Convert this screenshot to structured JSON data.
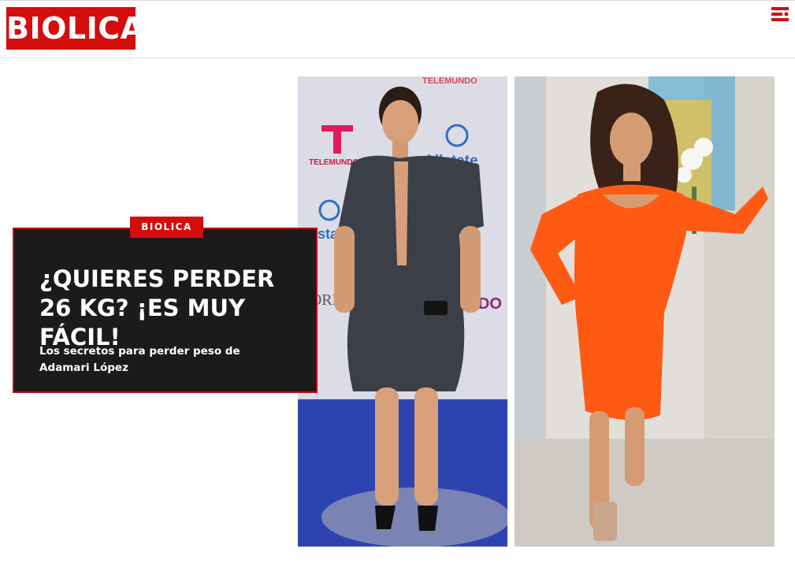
{
  "header": {
    "logo_text": "BIOLICA",
    "menu_icon": "menu-icon",
    "brand_color": "#d40d0d"
  },
  "article": {
    "category": "BIOLICA",
    "headline": "¿QUIERES PERDER 26 KG? ¡ES MUY FÁCIL!",
    "subheadline": "Los secretos para perder peso de Adamari López"
  },
  "photos": {
    "left": {
      "backdrop_text_1": "TELEMUNDO",
      "backdrop_text_2": "TELEMUNDO",
      "backdrop_text_3": "Allstate",
      "backdrop_text_4": "L'OREAL",
      "backdrop_text_5": "UNDO"
    }
  }
}
